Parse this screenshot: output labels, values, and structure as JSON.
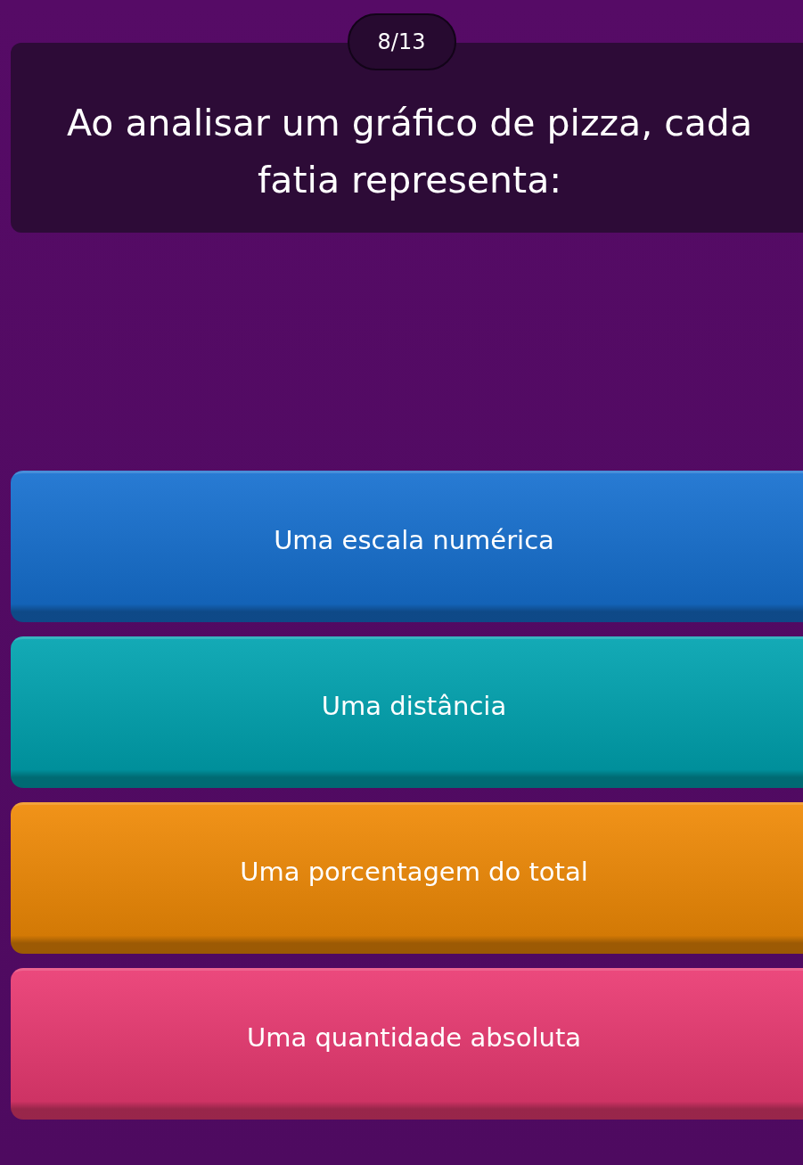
{
  "counter": "8/13",
  "question": "Ao analisar um gráfico de pizza, cada fatia representa:",
  "options": [
    {
      "label": "Uma escala numérica",
      "color": "#1670d0"
    },
    {
      "label": "Uma distância",
      "color": "#00a3b0"
    },
    {
      "label": "Uma porcentagem do total",
      "color": "#f08a06"
    },
    {
      "label": "Uma quantidade absoluta",
      "color": "#ea3a72"
    }
  ]
}
